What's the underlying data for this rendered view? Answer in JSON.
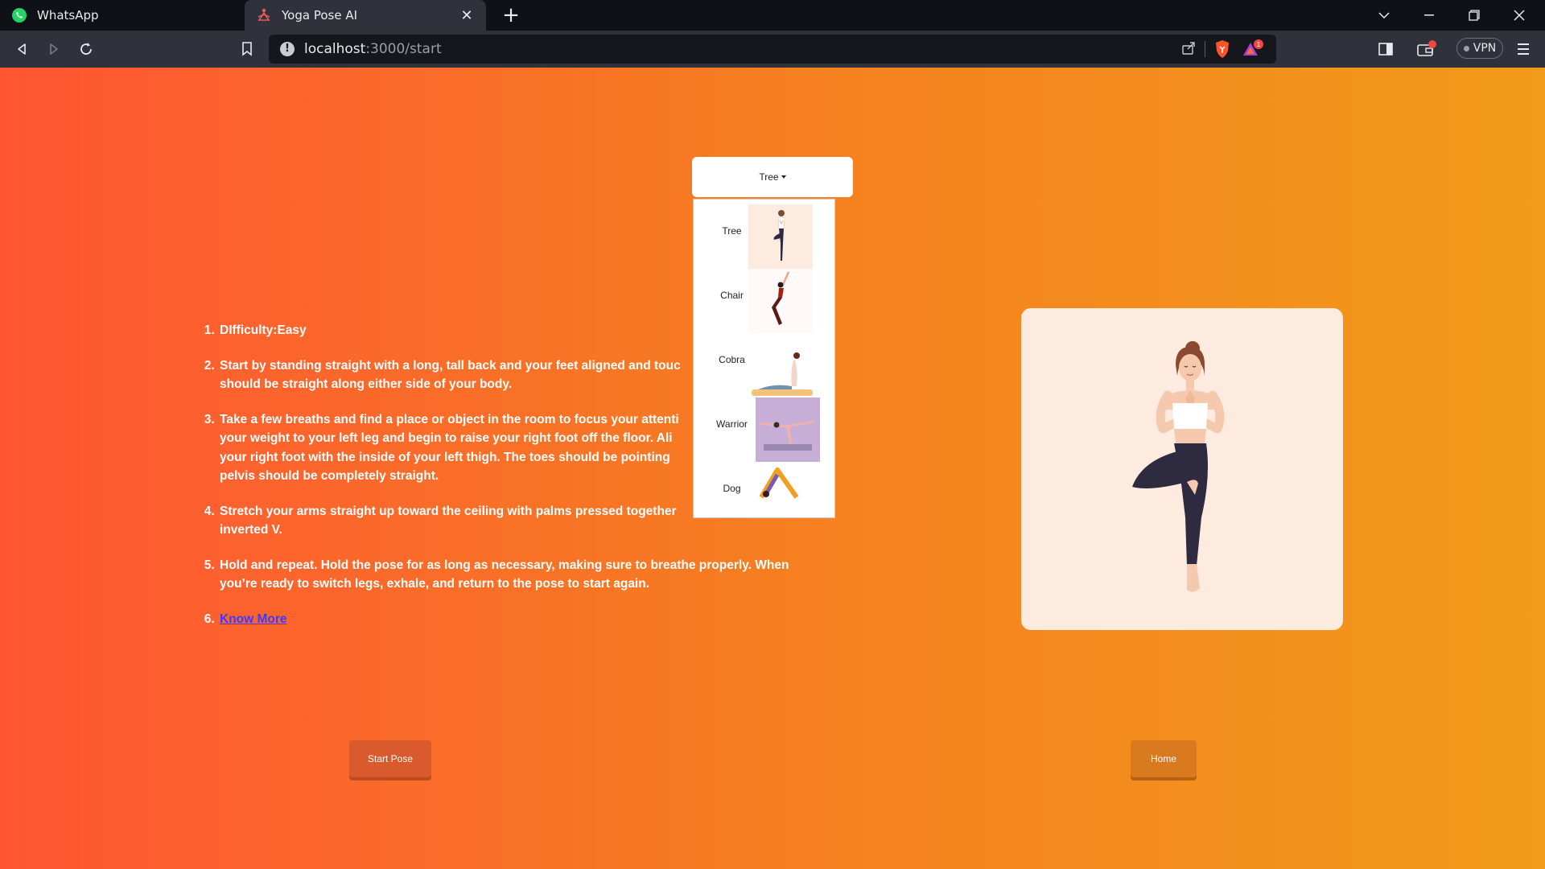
{
  "browser": {
    "tabs": [
      {
        "title": "WhatsApp",
        "icon": "whatsapp-icon",
        "active": false
      },
      {
        "title": "Yoga Pose AI",
        "icon": "yoga-icon",
        "active": true
      }
    ],
    "url_host": "localhost",
    "url_path": ":3000/start",
    "vpn_label": "VPN",
    "rewards_badge": "1"
  },
  "page": {
    "selected_pose": "Tree",
    "pose_menu": [
      {
        "label": "Tree",
        "icon": "tree-pose-icon"
      },
      {
        "label": "Chair",
        "icon": "chair-pose-icon"
      },
      {
        "label": "Cobra",
        "icon": "cobra-pose-icon"
      },
      {
        "label": "Warrior",
        "icon": "warrior-pose-icon"
      },
      {
        "label": "Dog",
        "icon": "dog-pose-icon"
      }
    ],
    "instructions": [
      "DIfficulty:Easy",
      "Start by standing straight with a long, tall back and your feet aligned and touc",
      "should be straight along either side of your body.",
      "Take a few breaths and find a place or object in the room to focus your attenti",
      "your weight to your left leg and begin to raise your right foot off the floor. Ali",
      "your right foot with the inside of your left thigh. The toes should be pointing",
      "pelvis should be completely straight.",
      "Stretch your arms straight up toward the ceiling with palms pressed together",
      "inverted V.",
      "Hold and repeat. Hold the pose for as long as necessary, making sure to breathe properly. When",
      "you’re ready to switch legs, exhale, and return to the pose to start again."
    ],
    "know_more_label": "Know More",
    "start_button": "Start Pose",
    "home_button": "Home",
    "colors": {
      "gradient_start": "#ff5533",
      "gradient_end": "#f29a1a",
      "card_bg": "#fdebdf",
      "start_button": "#d95a2c",
      "home_button": "#d97a1e"
    }
  }
}
